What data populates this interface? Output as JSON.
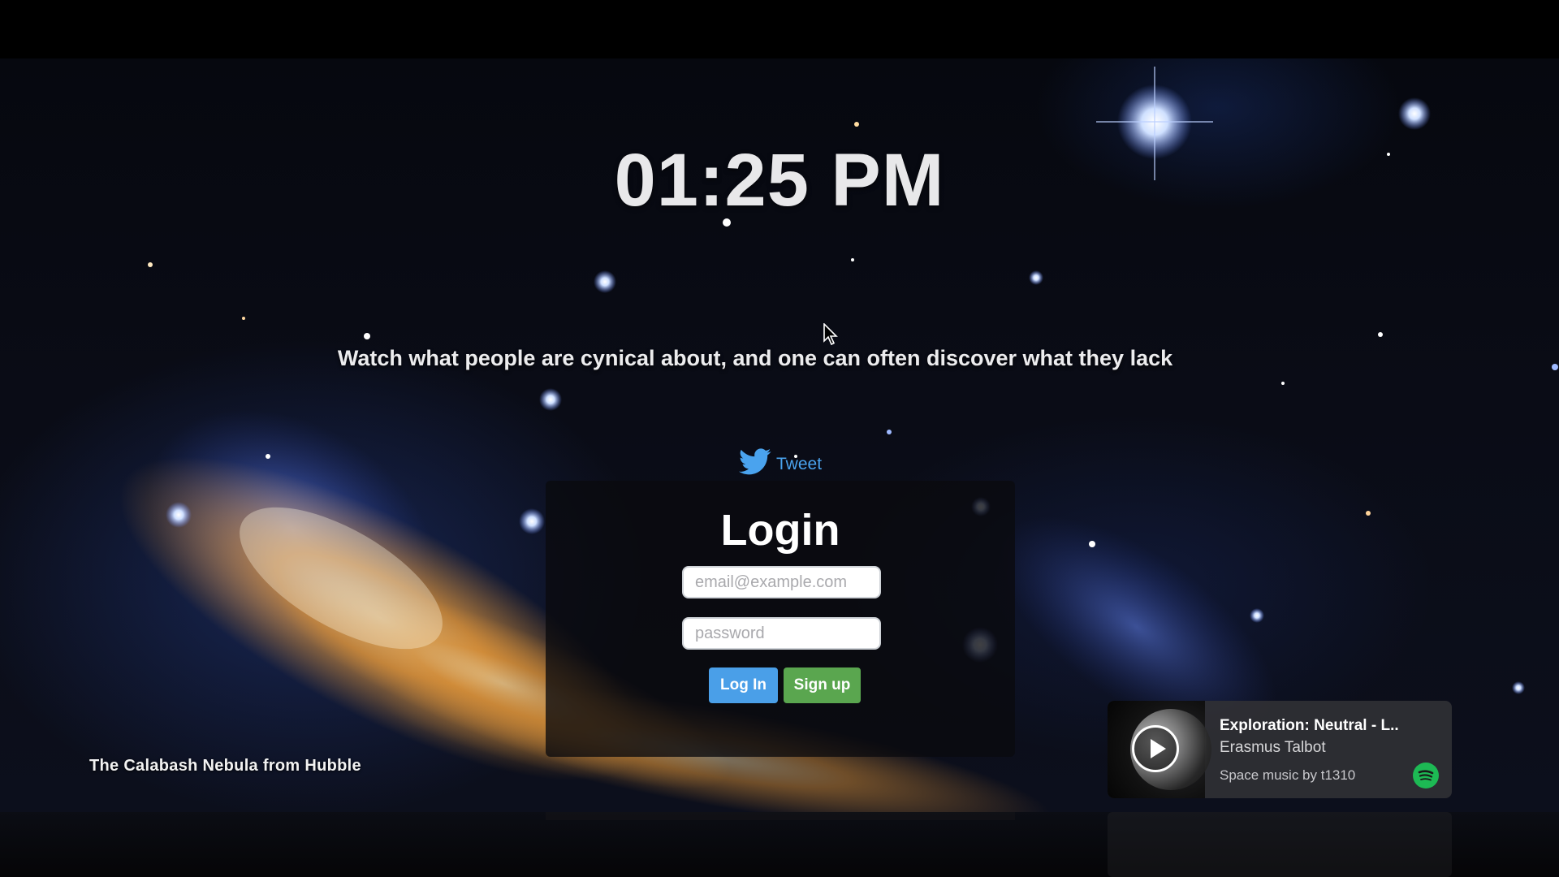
{
  "clock": {
    "time": "01:25 PM"
  },
  "quote": {
    "text": "Watch what people are cynical about, and one can often discover what they lack"
  },
  "tweet": {
    "label": "Tweet",
    "icon": "twitter-bird-icon",
    "color": "#4aa3ee"
  },
  "login": {
    "title": "Login",
    "email_placeholder": "email@example.com",
    "password_placeholder": "password",
    "login_label": "Log In",
    "signup_label": "Sign up"
  },
  "background": {
    "caption": "The Calabash Nebula from Hubble"
  },
  "music": {
    "title": "Exploration: Neutral - L..",
    "artist": "Erasmus Talbot",
    "source": "Space music by t1310",
    "play_icon": "play-icon",
    "service_icon": "spotify-icon",
    "service_color": "#1db954"
  },
  "colors": {
    "login_button": "#4a9fe8",
    "signup_button": "#5aa64f"
  }
}
